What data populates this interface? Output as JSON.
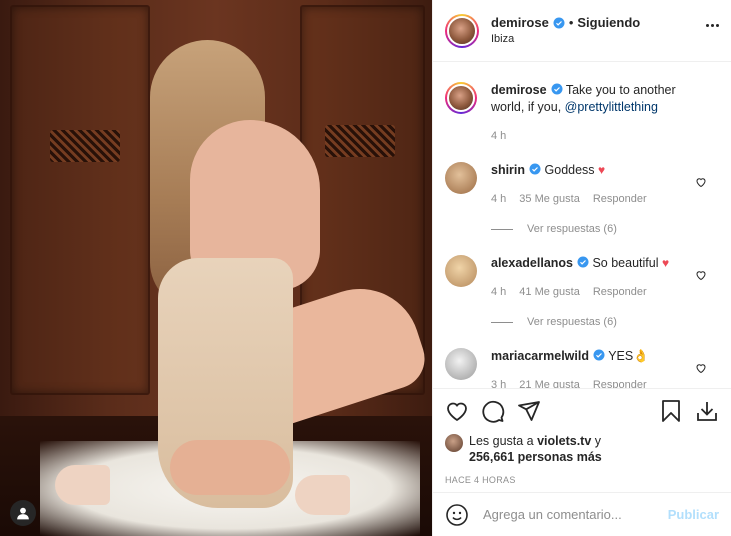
{
  "post": {
    "author": "demirose",
    "follow_sep": "•",
    "follow_label": "Siguiendo",
    "location": "Ibiza"
  },
  "caption": {
    "username": "demirose",
    "text": " Take you to another world, if you, ",
    "mention": "@prettylittlething",
    "time": "4 h"
  },
  "comments": [
    {
      "username": "shirin",
      "text": " Goddess ",
      "emoji": "♥",
      "time": "4 h",
      "likes": "35 Me gusta",
      "reply": "Responder",
      "replies": "Ver respuestas (6)"
    },
    {
      "username": "alexadellanos",
      "text": " So beautiful ",
      "emoji": "♥",
      "time": "4 h",
      "likes": "41 Me gusta",
      "reply": "Responder",
      "replies": "Ver respuestas (6)"
    },
    {
      "username": "mariacarmelwild",
      "text": " YES",
      "emoji": "👌",
      "time": "3 h",
      "likes": "21 Me gusta",
      "reply": "Responder"
    }
  ],
  "likes": {
    "prefix": "Les gusta a ",
    "user": "violets.tv",
    "suffix": " y",
    "count": "256,661 personas más"
  },
  "time_ago": "HACE 4 HORAS",
  "composer": {
    "placeholder": "Agrega un comentario...",
    "publish": "Publicar"
  },
  "colors": {
    "verified": "#3897f0",
    "heart": "#ed4956",
    "publish_disabled": "#b2dffc"
  },
  "icons": [
    "user-tag-icon",
    "more-options-icon",
    "verified-icon",
    "heart-outline-icon",
    "comment-icon",
    "share-icon",
    "bookmark-icon",
    "download-icon",
    "emoji-icon"
  ]
}
